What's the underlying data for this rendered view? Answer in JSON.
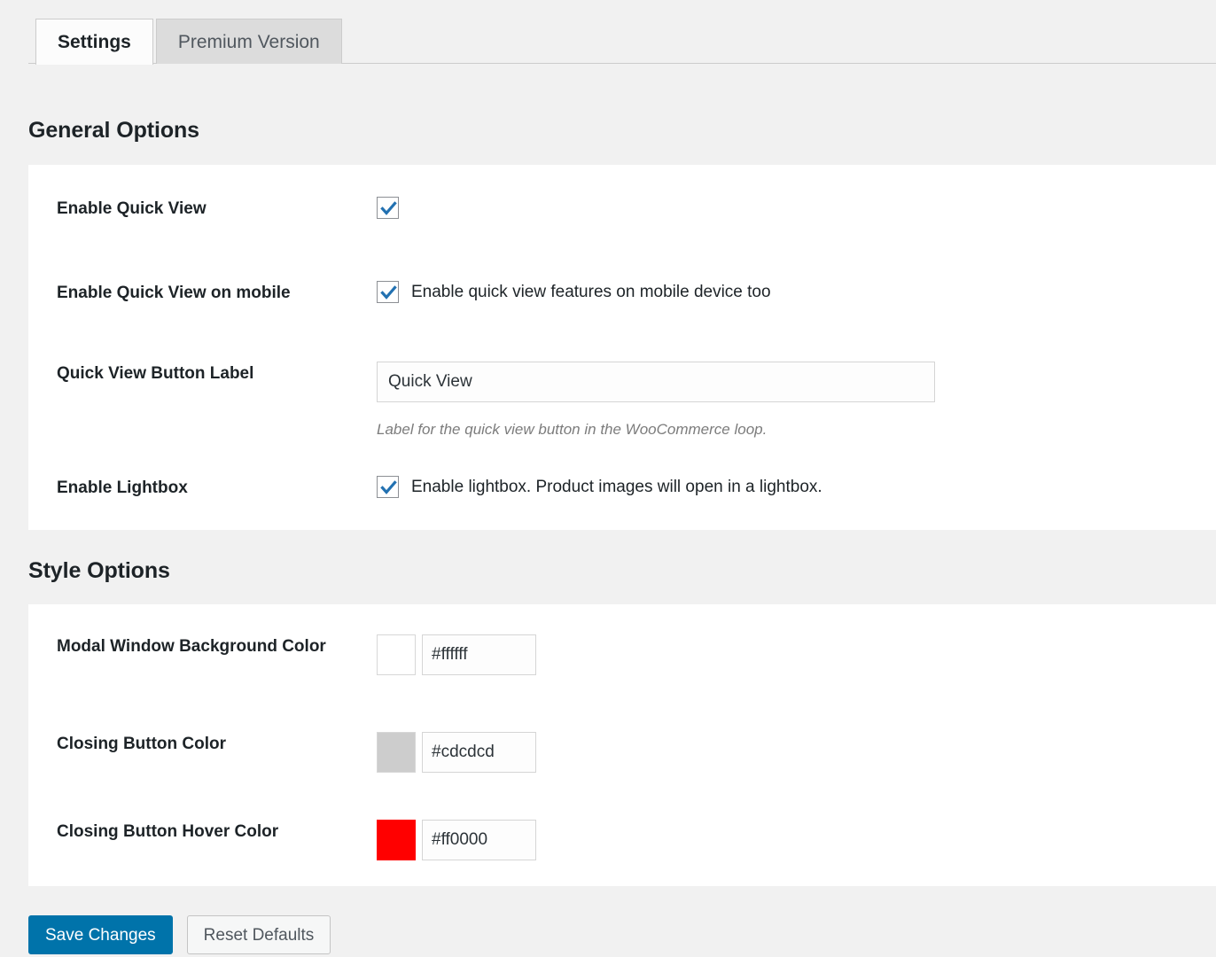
{
  "tabs": [
    {
      "label": "Settings",
      "active": true
    },
    {
      "label": "Premium Version",
      "active": false
    }
  ],
  "sections": {
    "general": {
      "title": "General Options",
      "rows": {
        "enable_quick_view": {
          "label": "Enable Quick View",
          "checked": true,
          "inline_text": ""
        },
        "enable_quick_view_mobile": {
          "label": "Enable Quick View on mobile",
          "checked": true,
          "inline_text": "Enable quick view features on mobile device too"
        },
        "quick_view_button_label": {
          "label": "Quick View Button Label",
          "value": "Quick View",
          "placeholder": "Quick View",
          "description": "Label for the quick view button in the WooCommerce loop."
        },
        "enable_lightbox": {
          "label": "Enable Lightbox",
          "checked": true,
          "inline_text": "Enable lightbox. Product images will open in a lightbox."
        }
      }
    },
    "style": {
      "title": "Style Options",
      "rows": {
        "modal_bg": {
          "label": "Modal Window Background Color",
          "value": "#ffffff",
          "swatch": "#ffffff"
        },
        "closing_button": {
          "label": "Closing Button Color",
          "value": "#cdcdcd",
          "swatch": "#cdcdcd"
        },
        "closing_button_hover": {
          "label": "Closing Button Hover Color",
          "value": "#ff0000",
          "swatch": "#ff0000"
        }
      }
    }
  },
  "footer": {
    "save_label": "Save Changes",
    "reset_label": "Reset Defaults"
  },
  "theme": {
    "page_background": "#f1f1f1",
    "panel_background": "#ffffff",
    "primary_button": "#0073aa",
    "checkbox_check": "#2271b1",
    "text_color": "#1d2327",
    "description_color": "#7c7c7c"
  }
}
